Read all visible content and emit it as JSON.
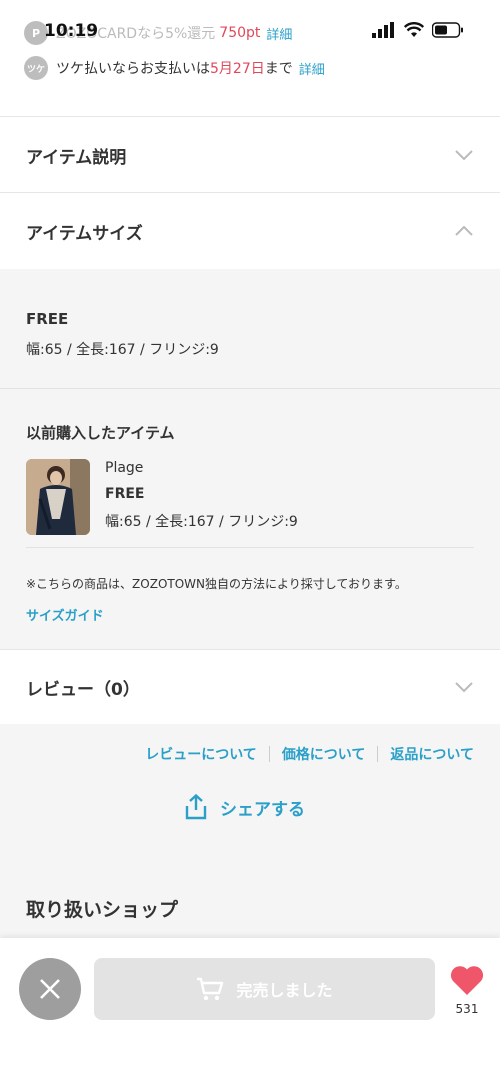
{
  "status_bar": {
    "time": "10:19"
  },
  "promos": {
    "card": {
      "badge": "P",
      "text": "ZOZOCARDなら5%還元",
      "points": "750pt",
      "link": "詳細"
    },
    "tsuke": {
      "badge": "ツケ",
      "text_before": "ツケ払いならお支払いは",
      "date": "5月27日",
      "text_after": "まで",
      "link": "詳細"
    }
  },
  "sections": {
    "item_description": {
      "title": "アイテム説明"
    },
    "item_size": {
      "title": "アイテムサイズ"
    },
    "review": {
      "title": "レビュー（0）"
    }
  },
  "size_table": {
    "label": "FREE",
    "dimensions": "幅:65 / 全長:167 / フリンジ:9"
  },
  "previous_purchase": {
    "heading": "以前購入したアイテム",
    "item": {
      "brand": "Plage",
      "size": "FREE",
      "dimensions": "幅:65 / 全長:167 / フリンジ:9"
    }
  },
  "size_note": "※こちらの商品は、ZOZOTOWN独自の方法により採寸しております。",
  "size_guide_link": "サイズガイド",
  "footer_links": [
    "レビューについて",
    "価格について",
    "返品について"
  ],
  "share_label": "シェアする",
  "shop_heading": "取り扱いショップ",
  "bottom_bar": {
    "cart_label": "完売しました",
    "favorite_count": "531"
  },
  "colors": {
    "accent": "#2aa0c9",
    "price_red": "#e0475a",
    "heart": "#f0566a"
  }
}
